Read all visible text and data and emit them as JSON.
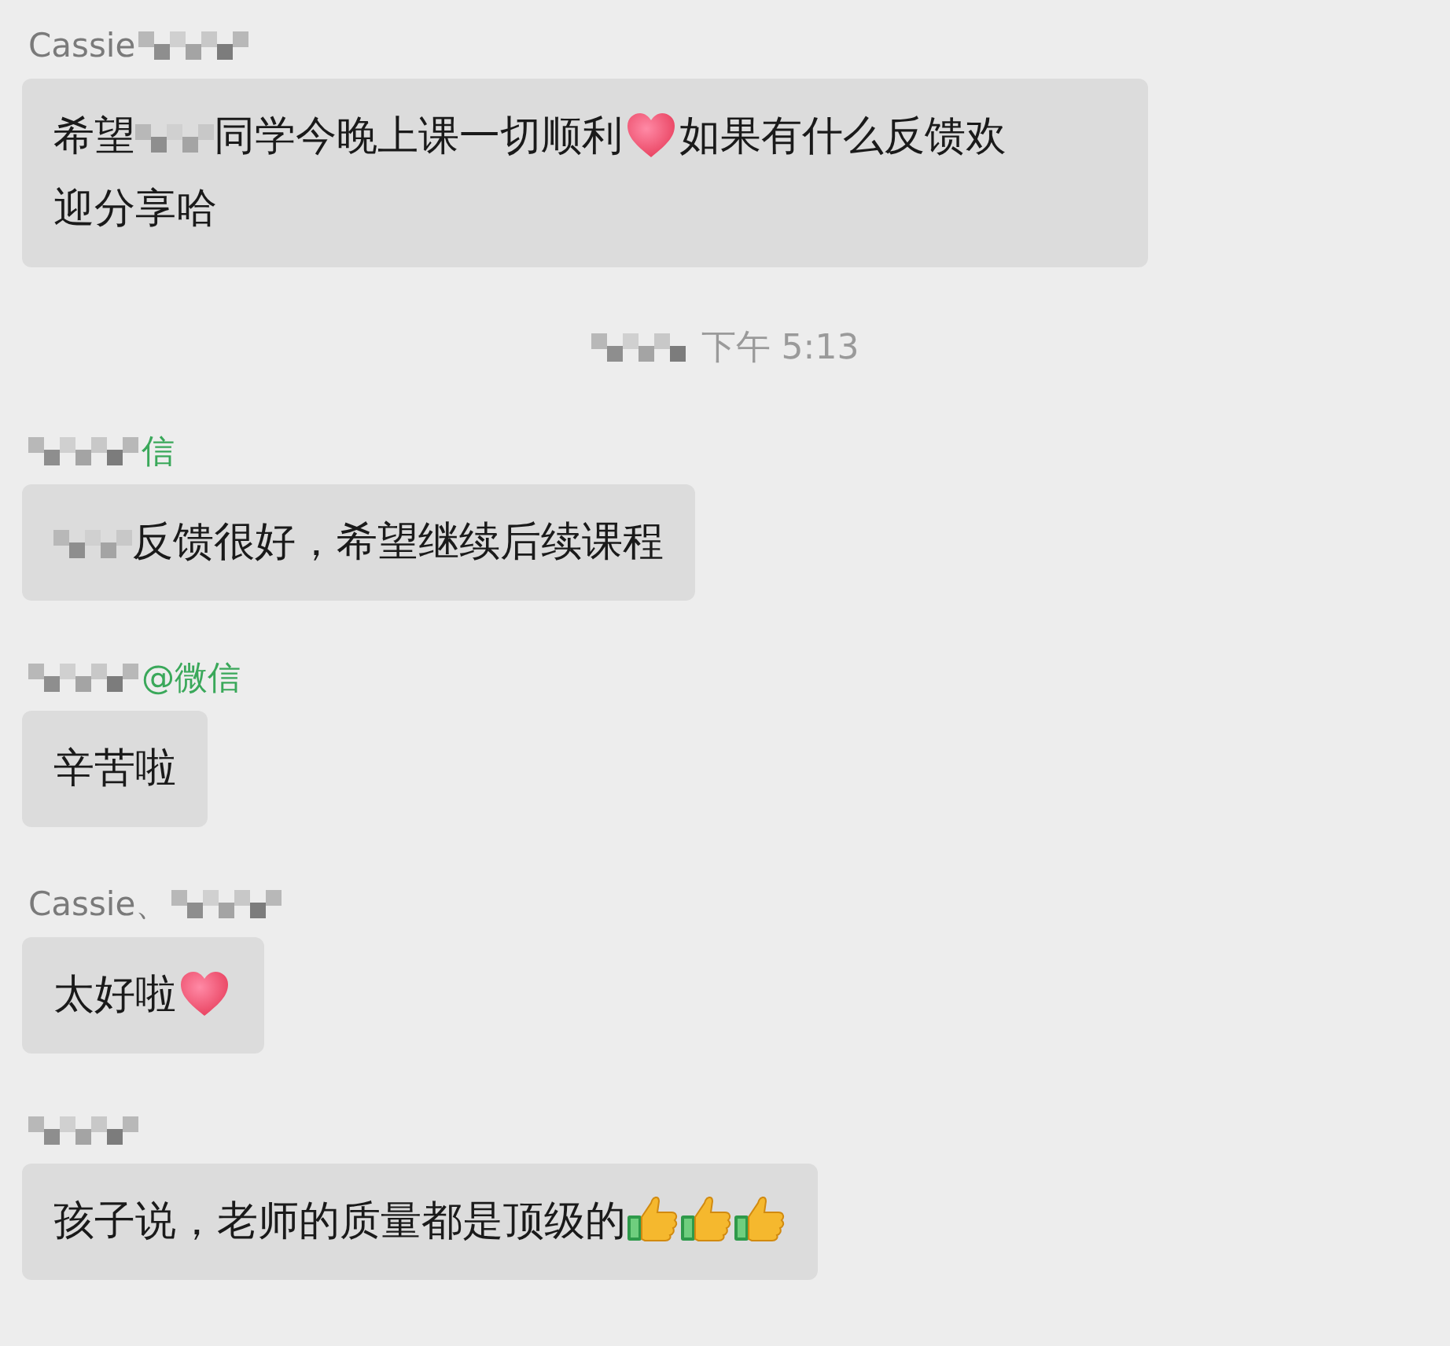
{
  "messages": [
    {
      "kind": "message",
      "sender": [
        {
          "kind": "text",
          "text": "Cassie"
        },
        {
          "kind": "redacted"
        }
      ],
      "content": [
        {
          "kind": "text",
          "text": "希望"
        },
        {
          "kind": "redacted"
        },
        {
          "kind": "text",
          "text": "同学今晚上课一切顺利"
        },
        {
          "kind": "heart"
        },
        {
          "kind": "text",
          "text": "如果有什么反馈欢"
        },
        {
          "kind": "text",
          "text": "迎分享哈"
        }
      ]
    },
    {
      "kind": "time",
      "content": [
        {
          "kind": "redacted"
        },
        {
          "kind": "text",
          "text": "下午 5:13"
        }
      ]
    },
    {
      "kind": "message",
      "sender": [
        {
          "kind": "redacted"
        },
        {
          "kind": "link",
          "text": "信"
        }
      ],
      "content": [
        {
          "kind": "redacted"
        },
        {
          "kind": "text",
          "text": "反馈很好，希望继续后续课程"
        }
      ]
    },
    {
      "kind": "message",
      "sender": [
        {
          "kind": "redacted"
        },
        {
          "kind": "link",
          "text": "@微信"
        }
      ],
      "content": [
        {
          "kind": "text",
          "text": "辛苦啦"
        }
      ]
    },
    {
      "kind": "message",
      "sender": [
        {
          "kind": "text",
          "text": "Cassie、"
        },
        {
          "kind": "redacted"
        }
      ],
      "content": [
        {
          "kind": "text",
          "text": "太好啦"
        },
        {
          "kind": "heart"
        }
      ]
    },
    {
      "kind": "message",
      "sender": [
        {
          "kind": "redacted"
        }
      ],
      "content": [
        {
          "kind": "text",
          "text": "孩子说，老师的质量都是顶级的"
        },
        {
          "kind": "thumbs"
        },
        {
          "kind": "thumbs"
        },
        {
          "kind": "thumbs"
        }
      ]
    }
  ]
}
